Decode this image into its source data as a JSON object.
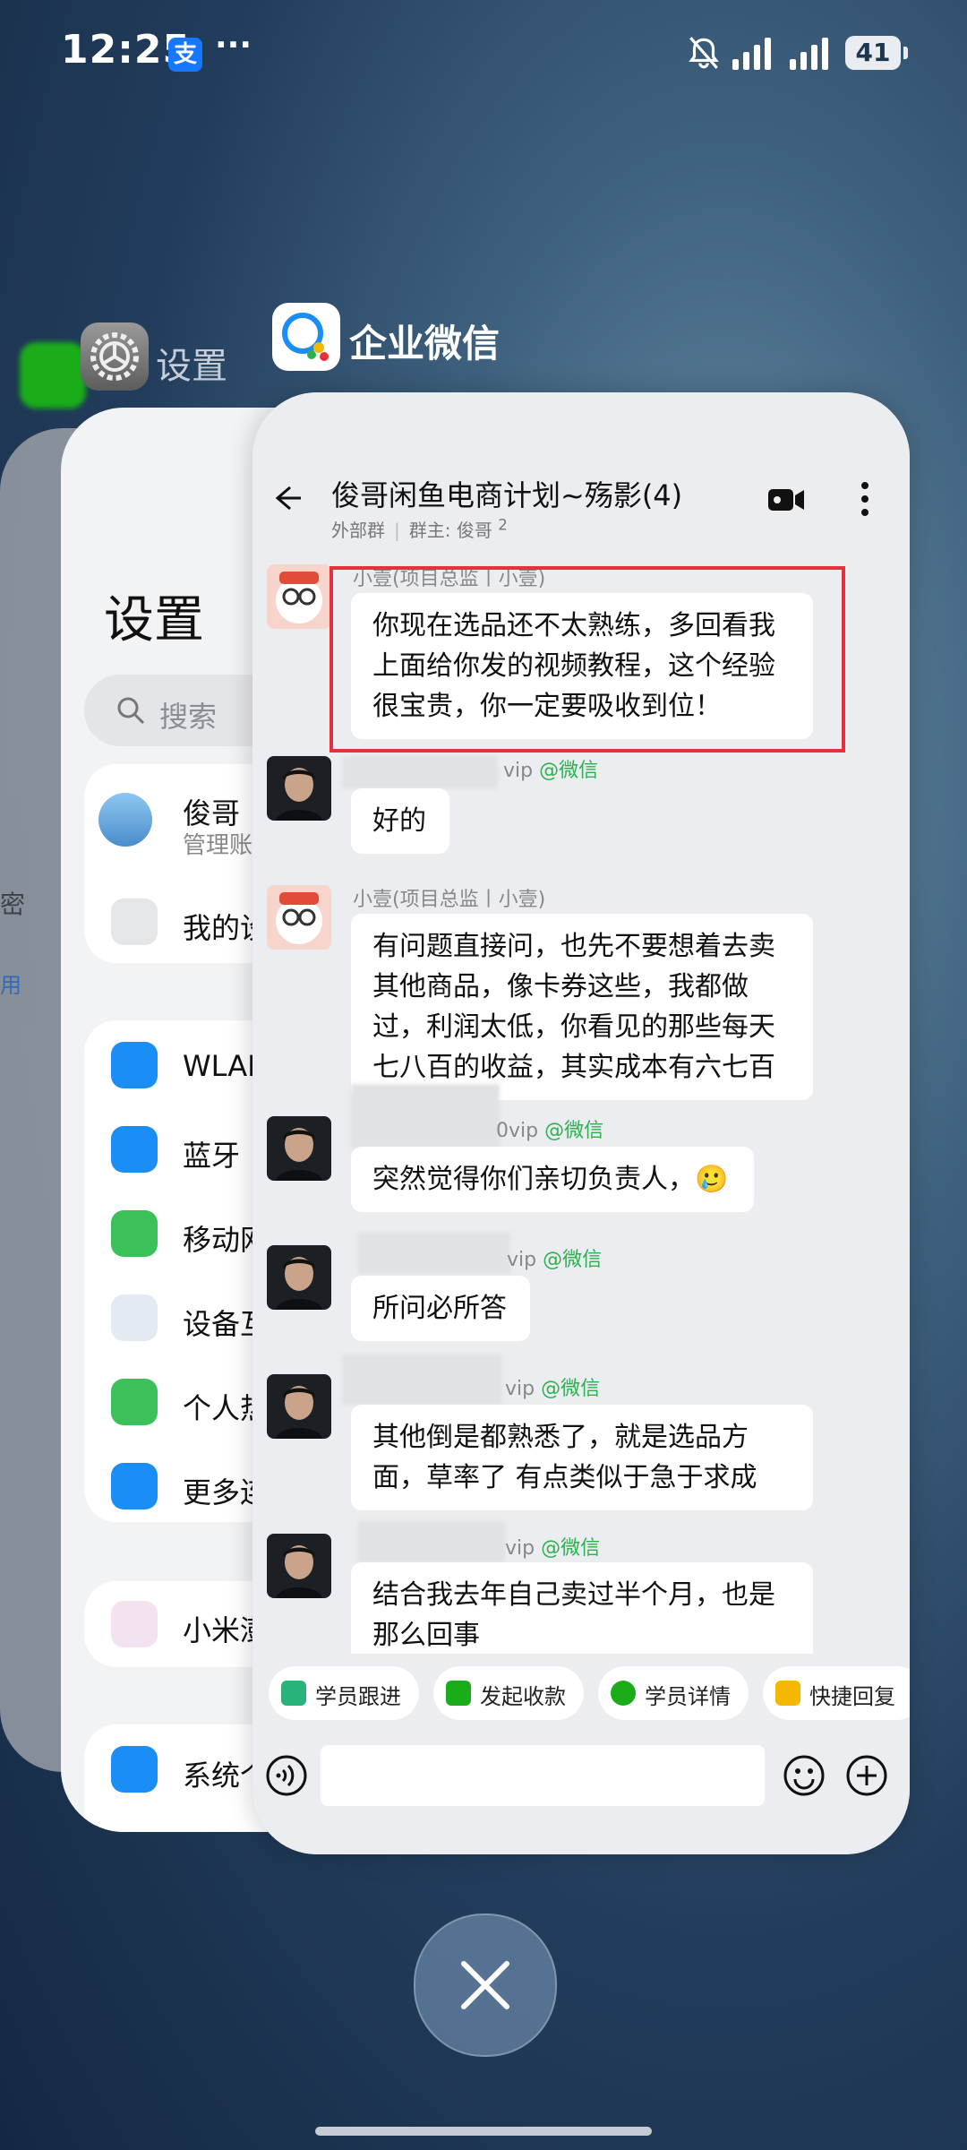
{
  "status_bar": {
    "time": "12:25",
    "alipay_glyph": "支",
    "more": "···",
    "battery": "41"
  },
  "recent_apps": {
    "back_app_icon": "wechat-icon",
    "settings": {
      "label": "设置",
      "title": "设置",
      "search_placeholder": "搜索",
      "account_name": "俊哥",
      "account_sub": "管理账",
      "device_item": "我的设",
      "items": [
        "WLAN",
        "蓝牙",
        "移动网",
        "设备互",
        "个人热",
        "更多连"
      ],
      "mi_item": "小米澎",
      "system_item": "系统个",
      "side_text_1": "密",
      "side_text_2": "用"
    },
    "main_app": {
      "name": "企业微信"
    }
  },
  "chat": {
    "title": "俊哥闲鱼电商计划~殇影(4)",
    "subtitle_tag": "外部群",
    "subtitle_owner": "群主: 俊哥",
    "subtitle_count": "2",
    "messages": [
      {
        "sender": "小壹(项目总监丨小壹)",
        "avatar": "bear",
        "text": "你现在选品还不太熟练，多回看我上面给你发的视频教程，这个经验很宝贵，你一定要吸收到位！"
      },
      {
        "sender_suffix": "vip",
        "sender_tag": "@微信",
        "avatar": "man",
        "text": "好的"
      },
      {
        "sender": "小壹(项目总监丨小壹)",
        "avatar": "bear",
        "text": "有问题直接问，也先不要想着去卖其他商品，像卡券这些，我都做过，利润太低，你看见的那些每天七八百的收益，其实成本有六七百"
      },
      {
        "sender_suffix": "0vip",
        "sender_tag": "@微信",
        "avatar": "man",
        "text": "突然觉得你们亲切负责人，",
        "emoji": "🥲"
      },
      {
        "sender_suffix": "vip",
        "sender_tag": "@微信",
        "avatar": "man",
        "text": "所问必所答"
      },
      {
        "sender_suffix": "vip",
        "sender_tag": "@微信",
        "avatar": "man",
        "text": "其他倒是都熟悉了，就是选品方面，草率了 有点类似于急于求成"
      },
      {
        "sender_suffix": "vip",
        "sender_tag": "@微信",
        "avatar": "man",
        "text": "结合我去年自己卖过半个月，也是那么回事"
      }
    ],
    "quick_actions": [
      {
        "label": "学员跟进",
        "color": "#2ab27b"
      },
      {
        "label": "发起收款",
        "color": "#1aad19"
      },
      {
        "label": "学员详情",
        "color": "#1aad19"
      },
      {
        "label": "快捷回复",
        "color": "#f5b800"
      }
    ]
  }
}
